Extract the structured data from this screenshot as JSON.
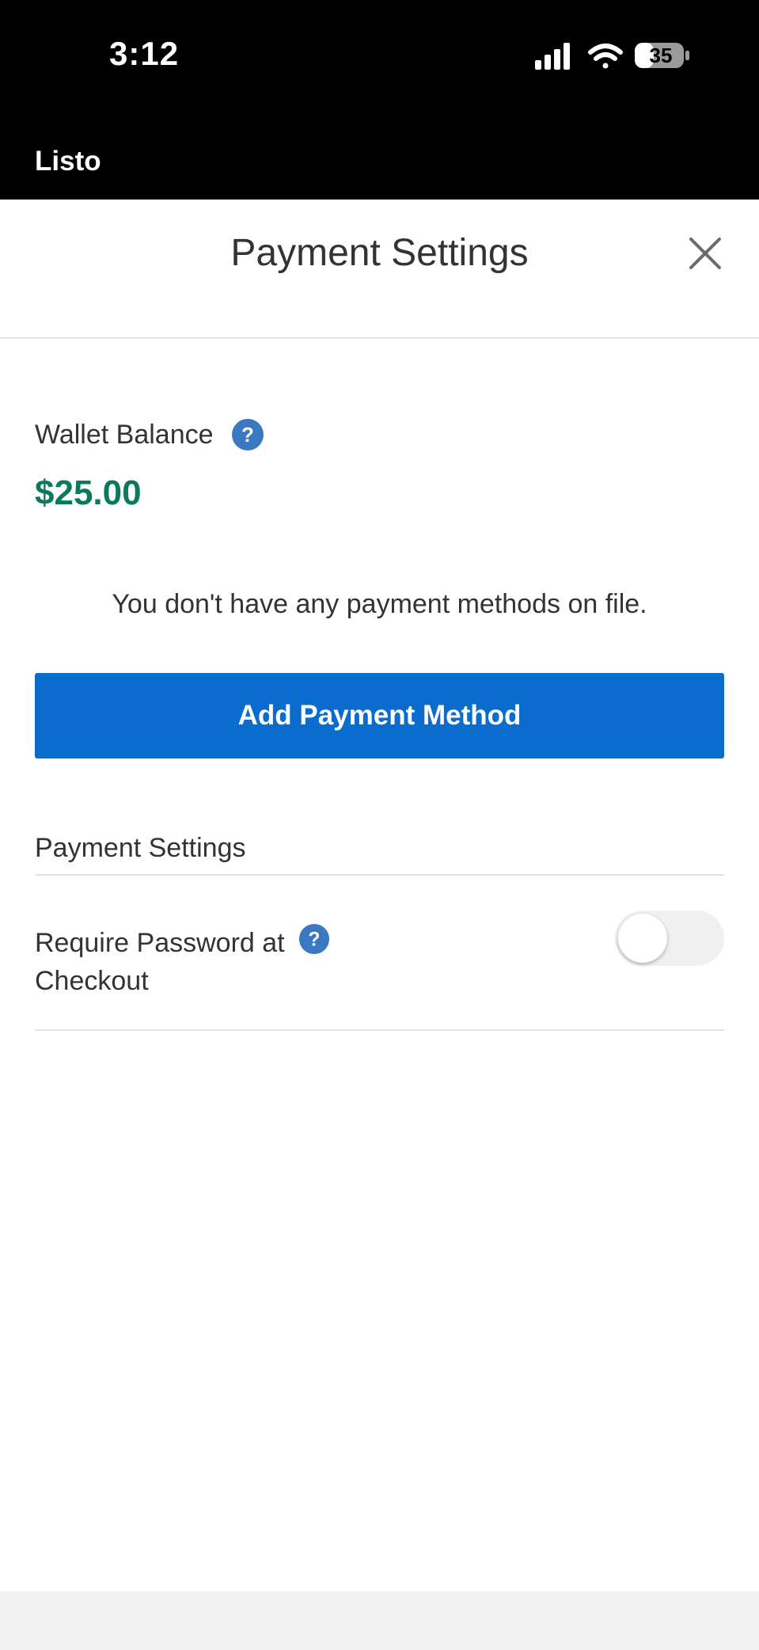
{
  "status_bar": {
    "time": "3:12",
    "battery": "35",
    "back_app_label": "Listo"
  },
  "header": {
    "title": "Payment Settings",
    "close_icon": "close-icon"
  },
  "wallet": {
    "label": "Wallet Balance",
    "amount": "$25.00",
    "help_icon": "question-circle-icon"
  },
  "payment_methods": {
    "empty_message": "You don't have any payment methods on file.",
    "add_button_label": "Add Payment Method"
  },
  "settings": {
    "section_title": "Payment Settings",
    "require_password": {
      "label_line1": "Require Password at",
      "label_line2": "Checkout",
      "enabled": false
    }
  },
  "colors": {
    "accent": "#0a6ccd",
    "balance": "#0b7a5c",
    "help_icon": "#3a78c2"
  }
}
